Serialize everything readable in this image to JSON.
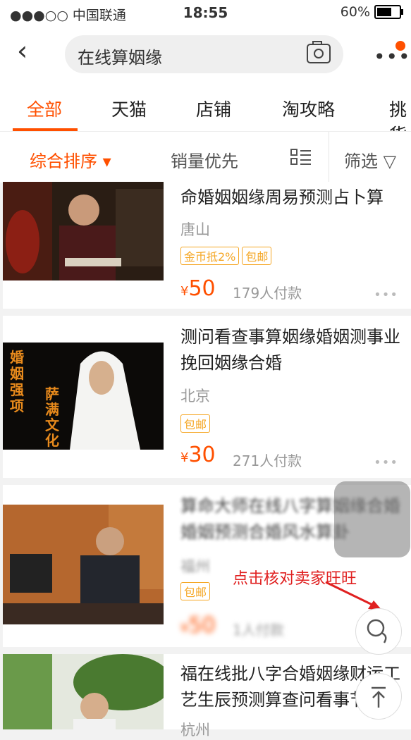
{
  "status": {
    "carrier": "●●●○○ 中国联通",
    "time": "18:55",
    "battery": "60%"
  },
  "search": {
    "query": "在线算姻缘"
  },
  "tabs": [
    "全部",
    "天猫",
    "店铺",
    "淘攻略",
    "挑货"
  ],
  "filters": {
    "sort": "综合排序",
    "sales": "销量优先",
    "filter": "筛选"
  },
  "items": [
    {
      "title": "命婚姻姻缘周易预测占卜算",
      "location": "唐山",
      "tags": [
        "金币抵2%",
        "包邮"
      ],
      "price": "50",
      "sold": "179人付款"
    },
    {
      "title": "测问看查事算姻缘婚姻测事业挽回姻缘合婚",
      "location": "北京",
      "tags": [
        "包邮"
      ],
      "price": "30",
      "sold": "271人付款",
      "thumb_text": [
        "婚姻强项",
        "萨满文化"
      ]
    },
    {
      "title": "算命大师在线八字算姻缘合婚婚姻预测合婚风水算卦",
      "location": "福州",
      "tags": [
        "包邮"
      ],
      "price": "50",
      "sold": "1人付款"
    },
    {
      "title": "福在线批八字合婚姻缘财运工艺生辰预测算查问看事节",
      "location": "杭州",
      "tags": [],
      "price": "",
      "sold": ""
    }
  ],
  "annotation": "点击核对卖家旺旺",
  "colors": {
    "accent": "#ff5000",
    "tag": "#f5a623",
    "annotation": "#e02020"
  }
}
